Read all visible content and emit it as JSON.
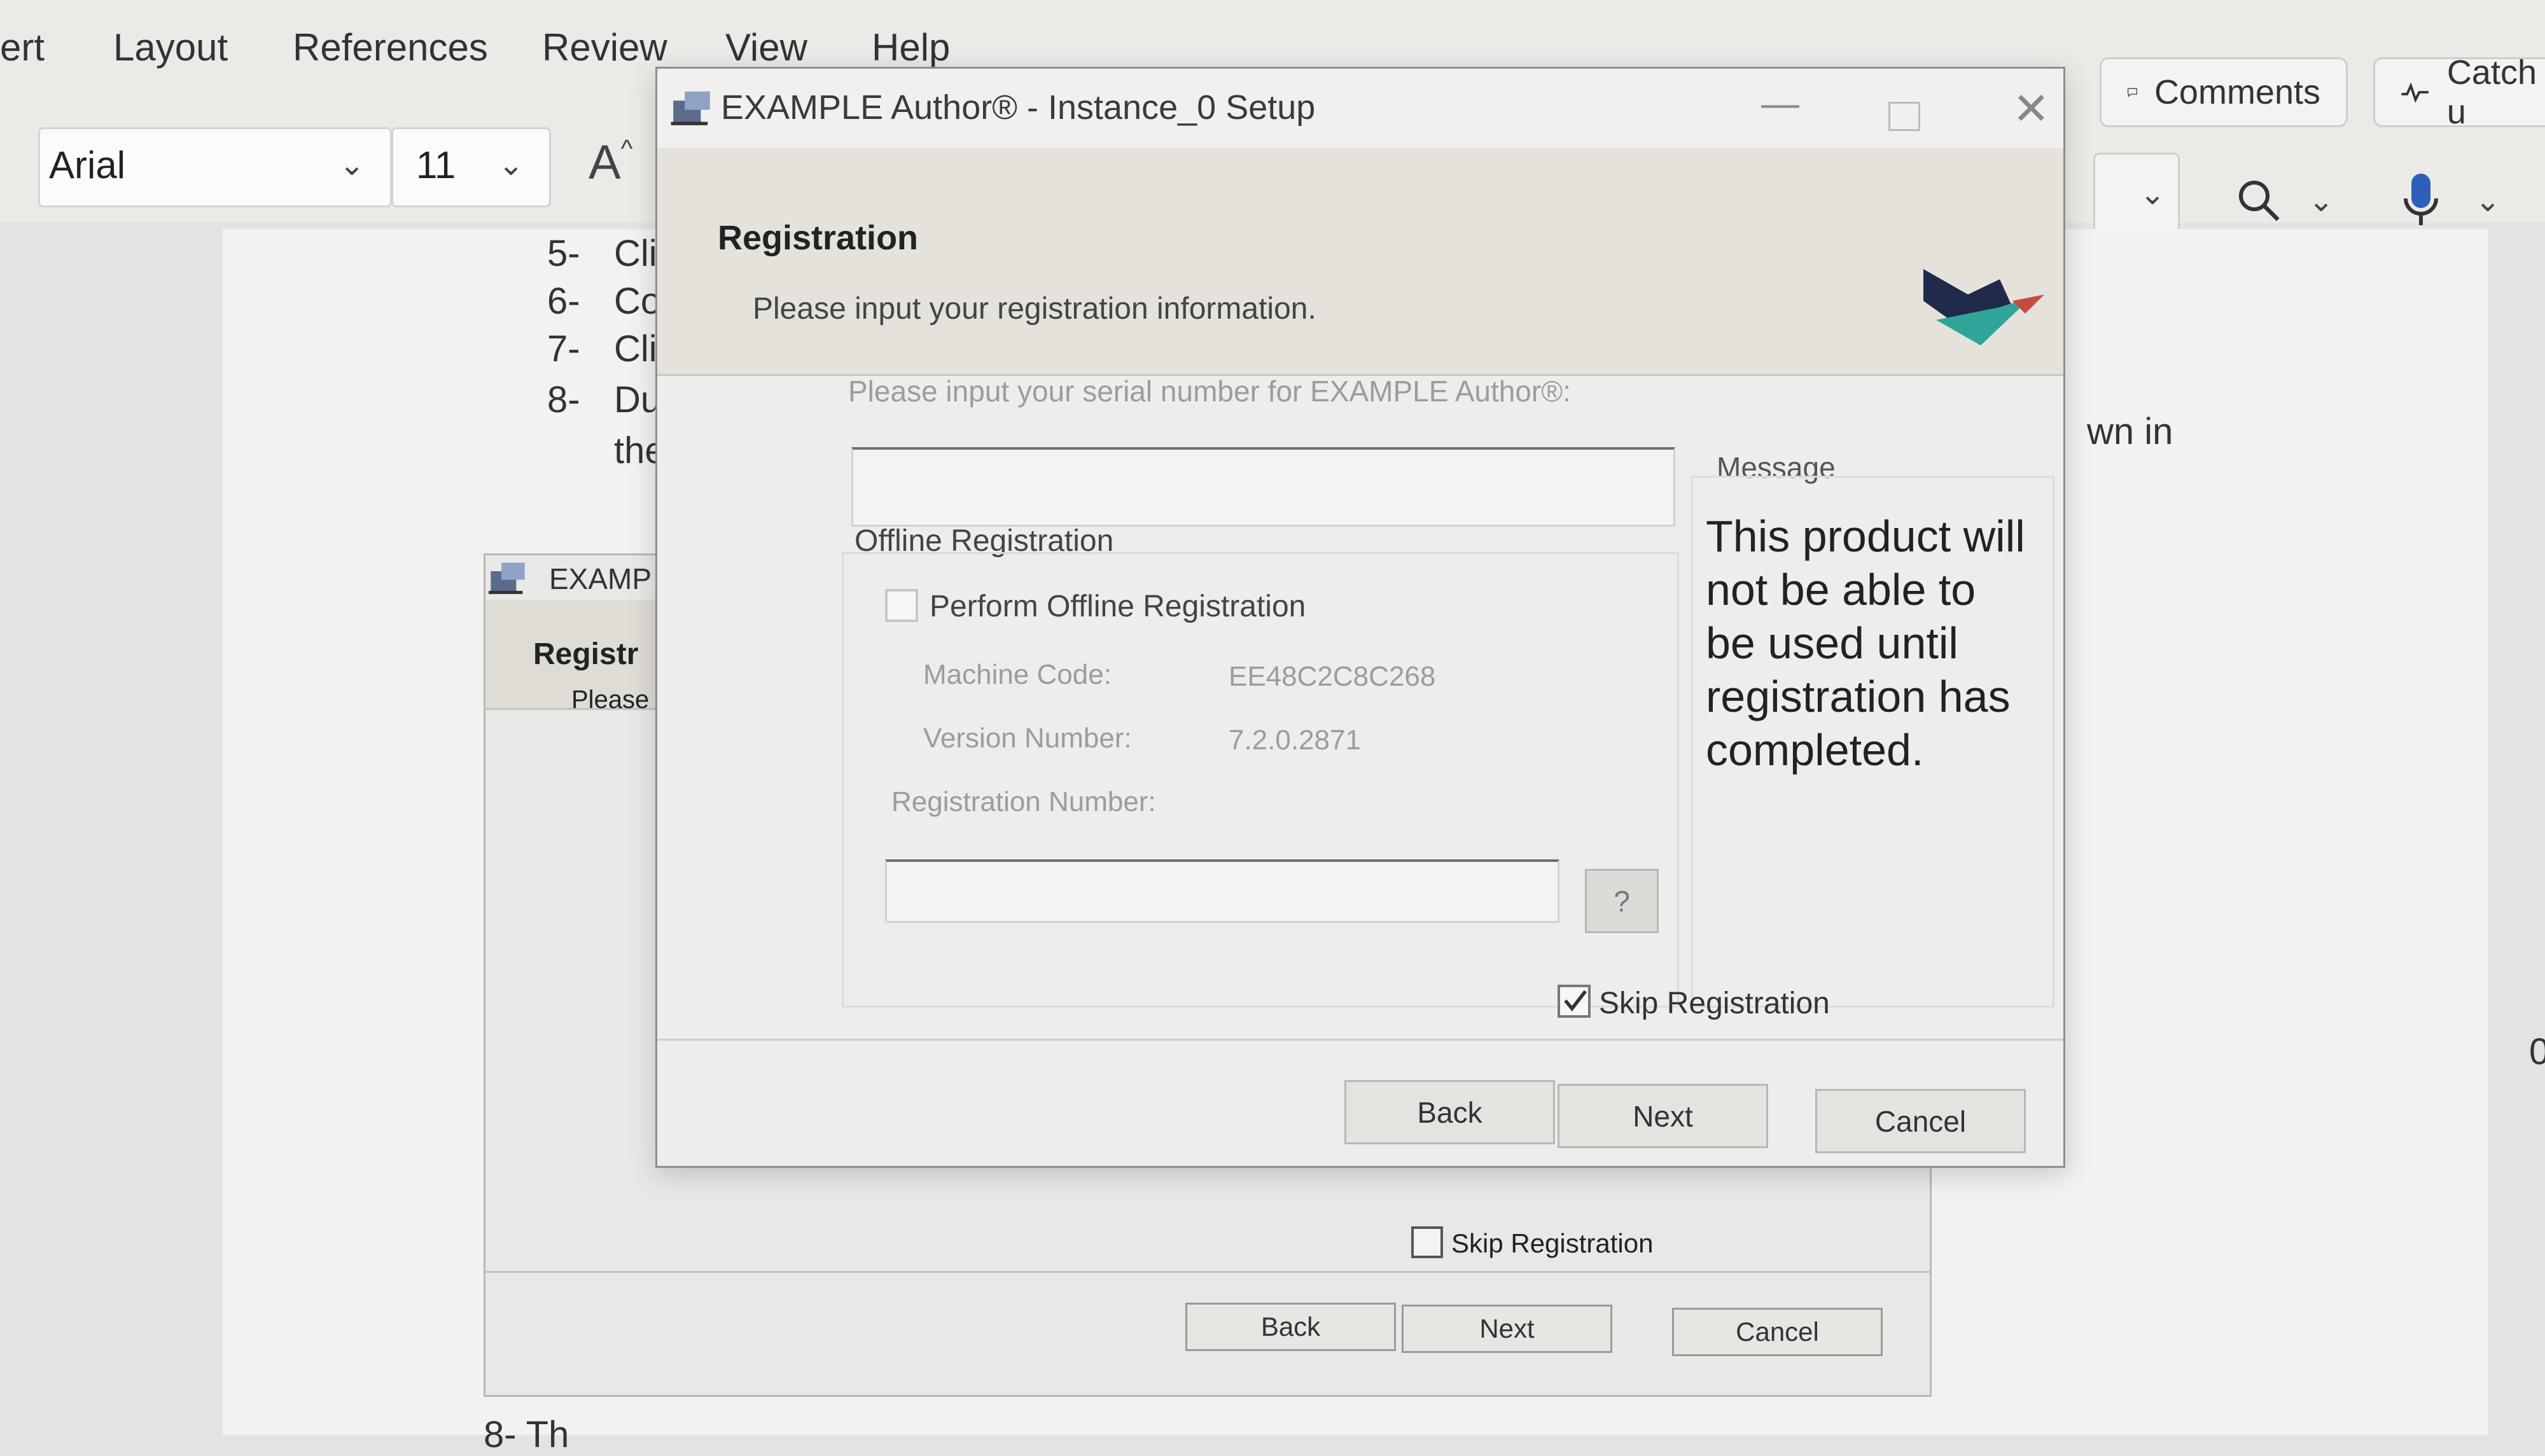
{
  "ribbon": {
    "menu_items": [
      "ert",
      "Layout",
      "References",
      "Review",
      "View",
      "Help"
    ],
    "font_name": "Arial",
    "font_size": "11",
    "grow_font_glyph": "A",
    "comments_label": "Comments",
    "catchup_label": "Catch u"
  },
  "document": {
    "steps": [
      {
        "num": "5-",
        "text": "Cli"
      },
      {
        "num": "6-",
        "text": "Co"
      },
      {
        "num": "7-",
        "text": "Cli"
      },
      {
        "num": "8-",
        "text": "Du"
      }
    ],
    "step8_continuation": "the",
    "right_fragment": "wn in",
    "edge_fragment": "0",
    "bottom_fragment": "8-  Th"
  },
  "bg_dialog": {
    "title": "EXAMP",
    "heading": "Registr",
    "subtitle": "Please",
    "skip_label": "Skip Registration",
    "back_label": "Back",
    "next_label": "Next",
    "cancel_label": "Cancel"
  },
  "dialog": {
    "title": "EXAMPLE Author® - Instance_0 Setup",
    "heading": "Registration",
    "subtitle": "Please input your registration information.",
    "serial_prompt": "Please input your serial number for EXAMPLE Author®:",
    "serial_value": "",
    "offline_group_label": "Offline Registration",
    "offline_checkbox_label": "Perform Offline Registration",
    "machine_code_label": "Machine Code:",
    "machine_code_value": "EE48C2C8C268",
    "version_label": "Version Number:",
    "version_value": "7.2.0.2871",
    "reg_number_label": "Registration Number:",
    "reg_number_value": "",
    "help_button": "?",
    "message_label": "Message",
    "message_text": "This product will not be able to be used until registration has completed.",
    "skip_label": "Skip Registration",
    "skip_checked": true,
    "back_label": "Back",
    "next_label": "Next",
    "cancel_label": "Cancel"
  },
  "colors": {
    "logo_dark": "#1f2a4a",
    "logo_teal": "#2fa59a",
    "logo_red": "#c84a3c",
    "mic_blue": "#2c5fb8"
  },
  "icons": [
    "installer-icon",
    "logo-icon",
    "minimize-icon",
    "maximize-icon",
    "close-icon",
    "comment-icon",
    "pulse-icon",
    "search-icon",
    "mic-icon",
    "chevron-down-icon"
  ]
}
